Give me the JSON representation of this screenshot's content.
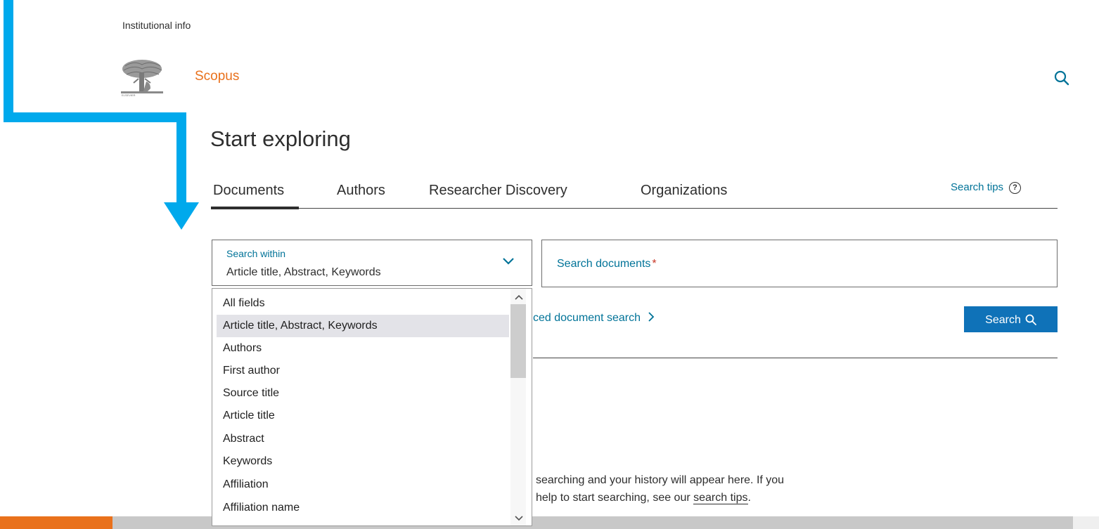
{
  "header": {
    "institutional_info": "Institutional info",
    "brand": "Scopus",
    "search_icon": "search-icon",
    "logo_icon": "elsevier-tree-logo-icon"
  },
  "annotation": {
    "arrow_color": "#00a9ec"
  },
  "page": {
    "title": "Start exploring"
  },
  "tabs": [
    {
      "label": "Documents",
      "active": true
    },
    {
      "label": "Authors",
      "active": false
    },
    {
      "label": "Researcher Discovery",
      "active": false
    },
    {
      "label": "Organizations",
      "active": false
    }
  ],
  "search_tips": {
    "label": "Search tips",
    "icon": "?"
  },
  "search_within": {
    "label": "Search within",
    "value": "Article title, Abstract, Keywords",
    "options": [
      "All fields",
      "Article title, Abstract, Keywords",
      "Authors",
      "First author",
      "Source title",
      "Article title",
      "Abstract",
      "Keywords",
      "Affiliation",
      "Affiliation name"
    ],
    "selected_index": 1
  },
  "documents_input": {
    "placeholder": "Search documents",
    "required_mark": "*"
  },
  "advanced_link": {
    "label": "ced document search",
    "chevron": ">"
  },
  "search_button": {
    "label": "Search"
  },
  "history": {
    "line1": "searching and your history will appear here. If you",
    "line2_prefix": "help to start searching, see our ",
    "line2_link": "search tips",
    "line2_suffix": "."
  },
  "colors": {
    "brand_orange": "#e9711c",
    "link_blue": "#007398",
    "button_blue": "#0f72b8",
    "annotation_blue": "#00a9ec"
  }
}
